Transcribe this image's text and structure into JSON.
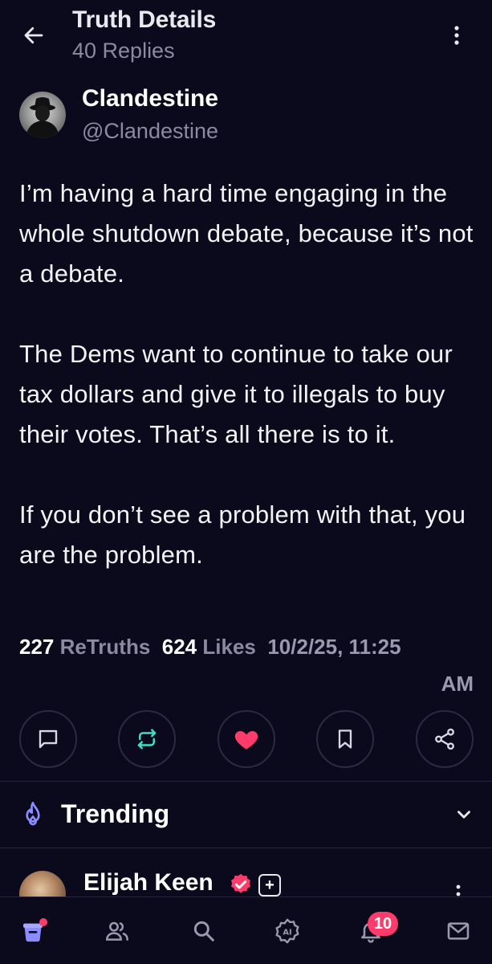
{
  "header": {
    "title": "Truth Details",
    "subtitle": "40 Replies"
  },
  "author": {
    "name": "Clandestine",
    "handle": "@Clandestine"
  },
  "post": {
    "paragraphs": [
      "I’m having a hard time engaging in the whole shutdown debate, because it’s not a debate.",
      "The Dems want to continue to take our tax dollars and give it to illegals to buy their votes. That’s all there is to it.",
      "If you don’t see a problem with that, you are the problem."
    ]
  },
  "stats": {
    "retruths_count": "227",
    "retruths_label": "ReTruths",
    "likes_count": "624",
    "likes_label": "Likes",
    "timestamp_line1": "10/2/25, 11:25",
    "timestamp_line2": "AM"
  },
  "actions": {
    "icons": [
      "reply-icon",
      "retruth-icon",
      "like-icon",
      "bookmark-icon",
      "share-icon"
    ],
    "retruth_color": "#3fe0c5",
    "like_color": "#ff3b6b"
  },
  "trending": {
    "label": "Trending",
    "accent": "#8b8cff"
  },
  "next_post": {
    "name": "Elijah Keen"
  },
  "bottom_nav": {
    "items": [
      "home-icon",
      "people-icon",
      "search-icon",
      "ai-icon",
      "notifications-icon",
      "messages-icon"
    ],
    "notifications_badge": "10",
    "home_color": "#8b8cff",
    "badge_color": "#ff3b6b"
  }
}
